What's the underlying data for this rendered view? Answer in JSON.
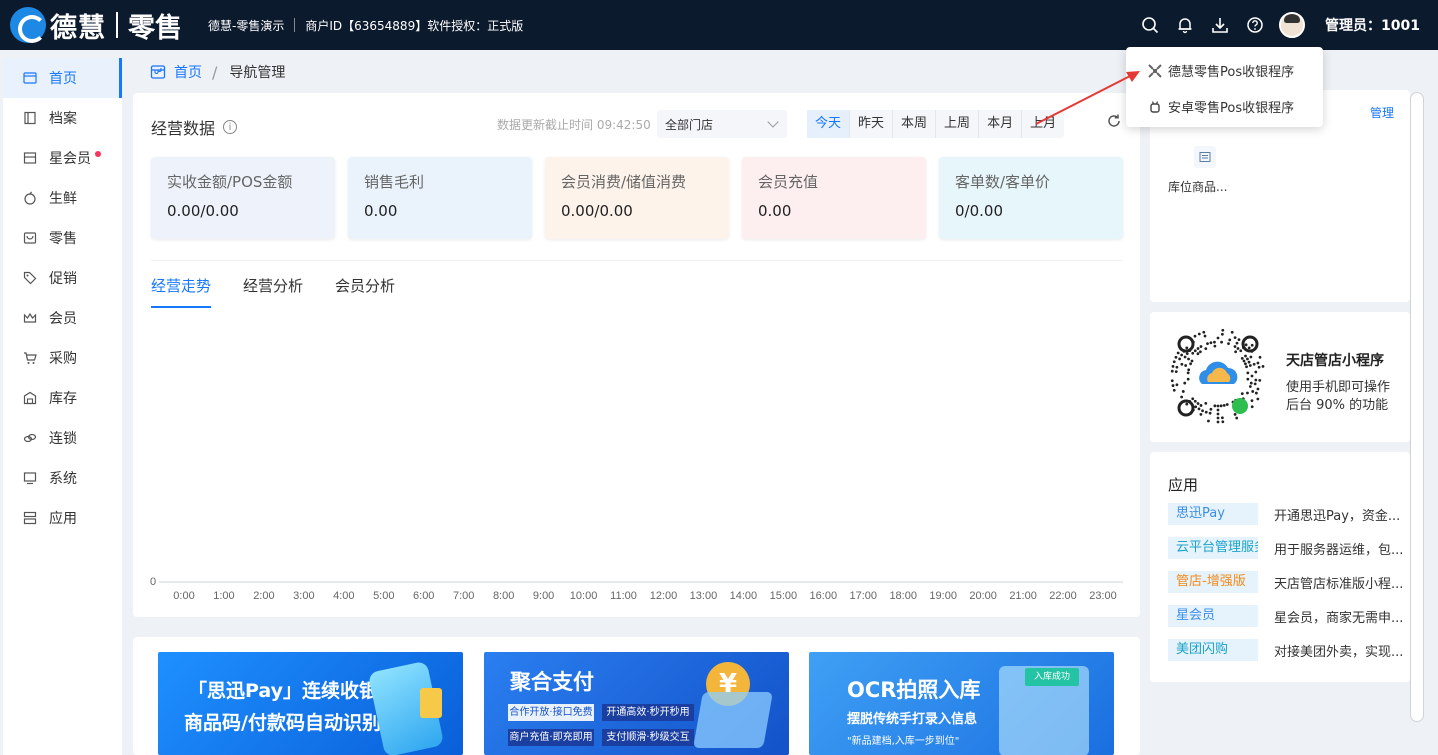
{
  "topbar": {
    "brand": "德慧",
    "brand_sub": "零售",
    "store_name": "德慧-零售演示",
    "merchant": "商户ID【63654889】软件授权：正式版",
    "admin": "管理员：1001",
    "icons": [
      "search-icon",
      "bell-icon",
      "download-icon",
      "help-icon"
    ]
  },
  "sidebar": {
    "items": [
      {
        "label": "首页",
        "icon": "store-icon",
        "active": true
      },
      {
        "label": "档案",
        "icon": "file-icon"
      },
      {
        "label": "星会员",
        "icon": "star-member-icon",
        "dot": true
      },
      {
        "label": "生鲜",
        "icon": "apple-icon"
      },
      {
        "label": "零售",
        "icon": "retail-icon"
      },
      {
        "label": "促销",
        "icon": "tag-icon"
      },
      {
        "label": "会员",
        "icon": "crown-icon"
      },
      {
        "label": "采购",
        "icon": "cart-icon"
      },
      {
        "label": "库存",
        "icon": "warehouse-icon"
      },
      {
        "label": "连锁",
        "icon": "chain-icon"
      },
      {
        "label": "系统",
        "icon": "monitor-icon"
      },
      {
        "label": "应用",
        "icon": "apps-icon"
      }
    ]
  },
  "breadcrumb": {
    "home": "首页",
    "current": "导航管理"
  },
  "ops": {
    "title": "经营数据",
    "update_time": "数据更新截止时间 09:42:50",
    "store_select": "全部门店",
    "periods": [
      "今天",
      "昨天",
      "本周",
      "上周",
      "本月",
      "上月"
    ],
    "active_period": "今天"
  },
  "stats": [
    {
      "label": "实收金额/POS金额",
      "value": "0.00/0.00",
      "bg": "#eef3fb"
    },
    {
      "label": "销售毛利",
      "value": "0.00",
      "bg": "#eaf3fc"
    },
    {
      "label": "会员消费/储值消费",
      "value": "0.00/0.00",
      "bg": "#fdf3ea"
    },
    {
      "label": "会员充值",
      "value": "0.00",
      "bg": "#fdeef0"
    },
    {
      "label": "客单数/客单价",
      "value": "0/0.00",
      "bg": "#e7f6fb"
    }
  ],
  "tabs": [
    {
      "label": "经营走势",
      "active": true
    },
    {
      "label": "经营分析"
    },
    {
      "label": "会员分析"
    }
  ],
  "chart_data": {
    "type": "line",
    "x": [
      "0:00",
      "1:00",
      "2:00",
      "3:00",
      "4:00",
      "5:00",
      "6:00",
      "7:00",
      "8:00",
      "9:00",
      "10:00",
      "11:00",
      "12:00",
      "13:00",
      "14:00",
      "15:00",
      "16:00",
      "17:00",
      "18:00",
      "19:00",
      "20:00",
      "21:00",
      "22:00",
      "23:00"
    ],
    "series": [
      {
        "values": [
          0,
          0,
          0,
          0,
          0,
          0,
          0,
          0,
          0,
          0,
          0,
          0,
          0,
          0,
          0,
          0,
          0,
          0,
          0,
          0,
          0,
          0,
          0,
          0
        ]
      }
    ],
    "yticks": [
      "0"
    ],
    "title": "",
    "xlabel": "",
    "ylabel": ""
  },
  "banners": [
    {
      "title": "「思迅Pay」连续收银",
      "subtitle": "商品码/付款码自动识别"
    },
    {
      "title": "聚合支付",
      "chips": [
        "合作开放·接口免费",
        "开通高效·秒开秒用",
        "商户充值·即充即用",
        "支付顺滑·秒级交互"
      ]
    },
    {
      "title": "OCR拍照入库",
      "subtitle": "摆脱传统手打录入信息",
      "note": "\"新品建档,入库一步到位\"",
      "badge": "入库成功"
    }
  ],
  "shortcut": {
    "manage": "管理",
    "item_label": "库位商品..."
  },
  "miniprogram": {
    "title": "天店管店小程序",
    "line1": "使用手机即可操作",
    "line2": "后台 90% 的功能"
  },
  "apps": {
    "title": "应用",
    "items": [
      {
        "tag": "思迅Pay",
        "desc": "开通思迅Pay，资金...",
        "color": "#3a8ee6"
      },
      {
        "tag": "云平台管理服务费",
        "desc": "用于服务器运维，包...",
        "color": "#1aa3c9"
      },
      {
        "tag": "管店-增强版",
        "desc": "天店管店标准版小程...",
        "color": "#f08c1a"
      },
      {
        "tag": "星会员",
        "desc": "星会员，商家无需申...",
        "color": "#3a8ee6"
      },
      {
        "tag": "美团闪购",
        "desc": "对接美团外卖，实现...",
        "color": "#1aa3c9"
      }
    ]
  },
  "dropdown": {
    "items": [
      {
        "label": "德慧零售Pos收银程序",
        "icon": "pos-icon"
      },
      {
        "label": "安卓零售Pos收银程序",
        "icon": "android-icon"
      }
    ]
  }
}
